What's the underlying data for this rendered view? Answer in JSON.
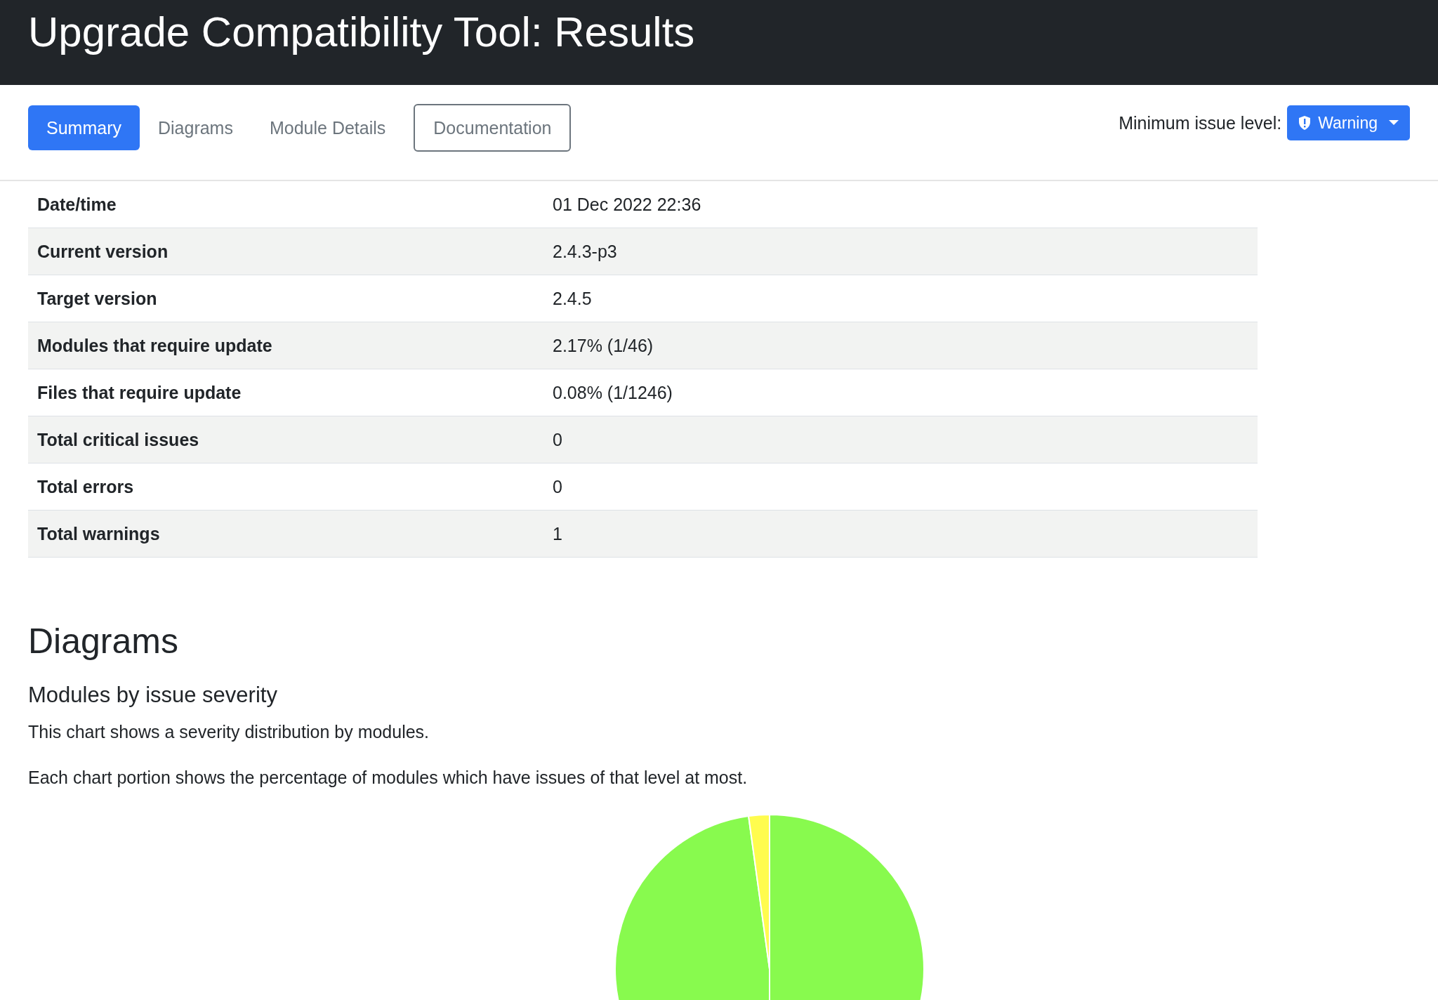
{
  "header": {
    "title": "Upgrade Compatibility Tool: Results"
  },
  "tabs": [
    {
      "label": "Summary",
      "selected": true
    },
    {
      "label": "Diagrams",
      "selected": false
    },
    {
      "label": "Module Details",
      "selected": false
    }
  ],
  "documentation_button": "Documentation",
  "issue_level": {
    "label": "Minimum issue level:",
    "value": "Warning"
  },
  "summary": [
    {
      "label": "Date/time",
      "value": "01 Dec 2022 22:36"
    },
    {
      "label": "Current version",
      "value": "2.4.3-p3"
    },
    {
      "label": "Target version",
      "value": "2.4.5"
    },
    {
      "label": "Modules that require update",
      "value": "2.17% (1/46)"
    },
    {
      "label": "Files that require update",
      "value": "0.08% (1/1246)"
    },
    {
      "label": "Total critical issues",
      "value": "0"
    },
    {
      "label": "Total errors",
      "value": "0"
    },
    {
      "label": "Total warnings",
      "value": "1"
    }
  ],
  "diagrams": {
    "title": "Diagrams",
    "subtitle": "Modules by issue severity",
    "paragraphs": [
      "This chart shows a severity distribution by modules.",
      "Each chart portion shows the percentage of modules which have issues of that level at most."
    ]
  }
}
